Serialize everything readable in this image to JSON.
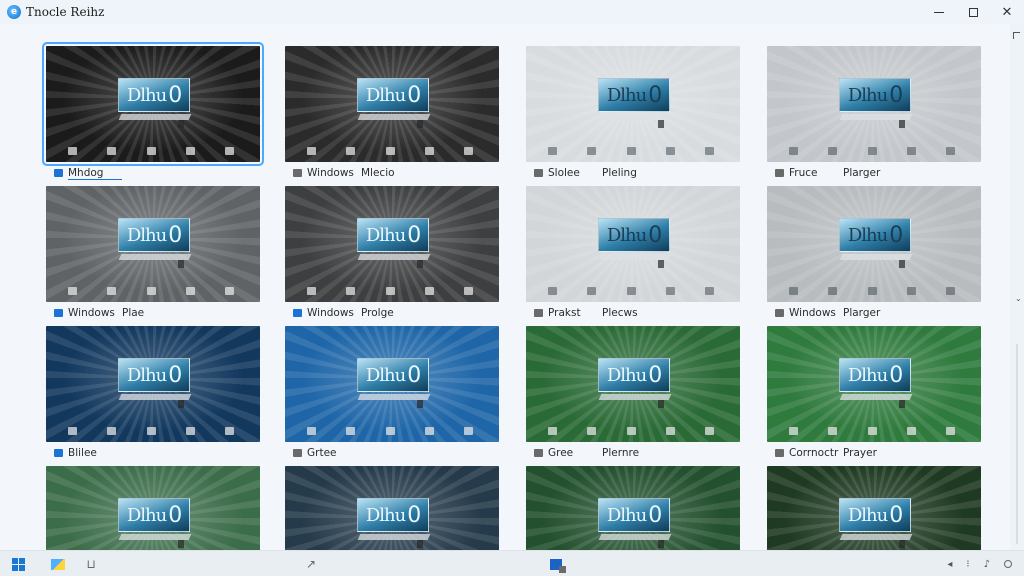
{
  "window": {
    "title": "Tnocle Reihz",
    "controls": {
      "minimize": "—",
      "maximize": "☐",
      "close": "✕"
    }
  },
  "tile_screen_text": "Dlhu",
  "tile_screen_circle": "0",
  "tiles": [
    {
      "bg": "#1b1b1b",
      "tone": "dark",
      "caption": [
        "Mhdog",
        ""
      ],
      "selected": true,
      "icon": "blue"
    },
    {
      "bg": "#2b2b2b",
      "tone": "dark",
      "caption": [
        "Windows",
        "Mlecio"
      ],
      "icon": "gray"
    },
    {
      "bg": "#d8dcdf",
      "tone": "light",
      "caption": [
        "Slolee",
        "Pleling"
      ],
      "icon": "gray"
    },
    {
      "bg": "#c3c7cb",
      "tone": "light",
      "caption": [
        "Fruce",
        "Plarger"
      ],
      "icon": "gray"
    },
    {
      "bg": "#5f6366",
      "tone": "dark",
      "caption": [
        "Windows",
        "Plae"
      ],
      "icon": "blue"
    },
    {
      "bg": "#3e3f40",
      "tone": "dark",
      "caption": [
        "Windows",
        "Prolge"
      ],
      "icon": "blue"
    },
    {
      "bg": "#d2d6d8",
      "tone": "light",
      "caption": [
        "Prakst",
        "Plecws"
      ],
      "icon": "gray"
    },
    {
      "bg": "#b8bcbf",
      "tone": "light",
      "caption": [
        "Windows",
        "Plarger"
      ],
      "icon": "gray"
    },
    {
      "bg": "#12385e",
      "tone": "dark",
      "caption": [
        "Blilee",
        ""
      ],
      "icon": "blue"
    },
    {
      "bg": "#1e66a8",
      "tone": "dark",
      "caption": [
        "Grtee",
        ""
      ],
      "icon": "gray"
    },
    {
      "bg": "#2a6a36",
      "tone": "dark",
      "caption": [
        "Gree",
        "Plernre"
      ],
      "icon": "gray"
    },
    {
      "bg": "#2f7a3d",
      "tone": "dark",
      "caption": [
        "Corrnoctr",
        "Prayer"
      ],
      "icon": "gray"
    },
    {
      "bg": "#3c6d4a",
      "tone": "dark",
      "caption": [
        "",
        ""
      ],
      "icon": "gray"
    },
    {
      "bg": "#253a4a",
      "tone": "dark",
      "caption": [
        "",
        ""
      ],
      "icon": "gray"
    },
    {
      "bg": "#23502e",
      "tone": "dark",
      "caption": [
        "",
        ""
      ],
      "icon": "gray"
    },
    {
      "bg": "#1f3a22",
      "tone": "dark",
      "caption": [
        "",
        ""
      ],
      "icon": "gray"
    }
  ],
  "taskbar": {
    "start_icon": "windows-start-icon",
    "app_icons": [
      "photos-icon",
      "file-icon",
      "tool-icon",
      "store-icon"
    ]
  }
}
